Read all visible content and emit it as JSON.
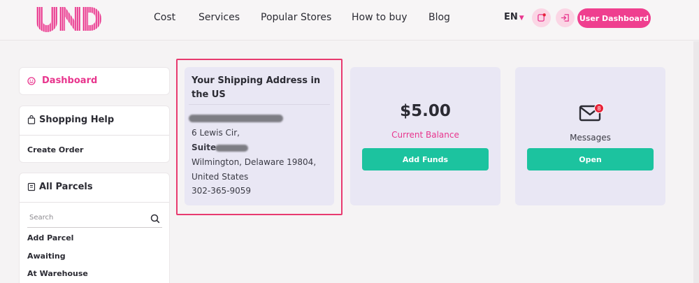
{
  "header": {
    "logo_text": "UND",
    "nav": [
      "Cost",
      "Services",
      "Popular Stores",
      "How to buy",
      "Blog"
    ],
    "language": "EN",
    "user_dashboard_label": "User Dashboard"
  },
  "sidebar": {
    "dashboard_label": "Dashboard",
    "shopping_help": {
      "title": "Shopping Help",
      "items": [
        "Create Order"
      ]
    },
    "all_parcels": {
      "title": "All Parcels",
      "search_placeholder": "Search",
      "items": [
        "Add Parcel",
        "Awaiting",
        "At Warehouse"
      ]
    }
  },
  "address_card": {
    "title": "Your Shipping Address in the US",
    "street": "6 Lewis Cir,",
    "suite_label": "Suite",
    "city_line": "Wilmington, Delaware 19804,",
    "country": "United States",
    "phone": "302-365-9059"
  },
  "balance_card": {
    "amount": "$5.00",
    "label": "Current Balance",
    "button_label": "Add Funds"
  },
  "messages_card": {
    "badge_count": "8",
    "label": "Messages",
    "button_label": "Open"
  },
  "colors": {
    "brand_pink": "#ef3f8f",
    "accent_green": "#1cc39f",
    "highlight_red": "#e83a6f",
    "card_bg": "#e9e7f4"
  }
}
